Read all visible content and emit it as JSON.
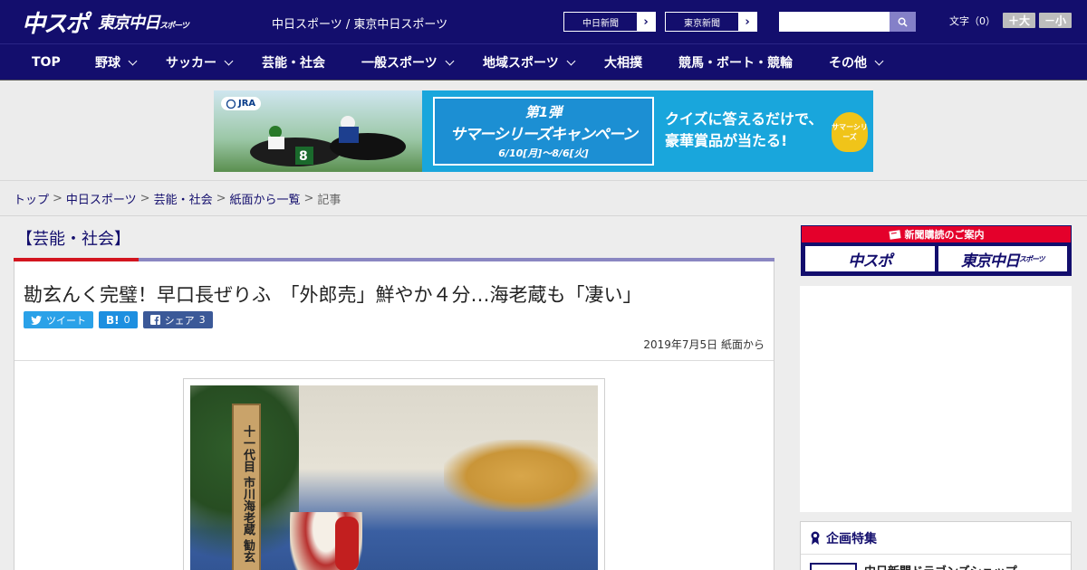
{
  "header": {
    "logo_main": "中スポ",
    "logo_sub": "東京中日",
    "logo_sub_small": "スポーツ",
    "sitename": "中日スポーツ / 東京中日スポーツ",
    "paper_buttons": [
      "中日新聞",
      "東京新聞"
    ],
    "search_placeholder": "",
    "fontsize_label": "文字（0）",
    "fontsize_bigger": "＋大",
    "fontsize_smaller": "－小"
  },
  "nav": {
    "items": [
      {
        "label": "TOP"
      },
      {
        "label": "野球"
      },
      {
        "label": "サッカー"
      },
      {
        "label": "芸能・社会"
      },
      {
        "label": "一般スポーツ"
      },
      {
        "label": "地域スポーツ"
      },
      {
        "label": "大相撲"
      },
      {
        "label": "競馬・ボート・競輪"
      },
      {
        "label": "その他"
      }
    ]
  },
  "banner": {
    "brand": "JRA",
    "box_line1": "第1弾",
    "box_line2": "サマーシリーズキャンペーン",
    "box_line3": "6/10[月]～8/6[火]",
    "message_line1": "クイズに答えるだけで、",
    "message_line2": "豪華賞品が当たる!",
    "badge": "サマーシリーズ"
  },
  "breadcrumb": {
    "items": [
      "トップ",
      "中日スポーツ",
      "芸能・社会",
      "紙面から一覧"
    ],
    "current": "記事"
  },
  "article": {
    "category": "【芸能・社会】",
    "title": "勘玄んく完璧！早口長ぜりふ　「外郎売」鮮やか４分…海老蔵も「凄い」",
    "share": {
      "tweet_label": "ツイート",
      "hatena_label": "B!",
      "hatena_count": "0",
      "facebook_label": "シェア",
      "facebook_count": "3"
    },
    "date": "2019年7月5日 紙面から",
    "photo_sign_text": "十一代目 市川海老蔵 勧玄"
  },
  "sidebar": {
    "subscribe_header": "新聞購読のご案内",
    "subscribe_logo1": "中スポ",
    "subscribe_logo2": "東京中日",
    "subscribe_logo2_small": "スポーツ",
    "feature_title": "企画特集",
    "feature_item": "中日新聞ドラゴンズショップ"
  },
  "colors": {
    "brand_navy": "#130e6d",
    "accent_red": "#d3151f",
    "subscribe_red": "#e4002b",
    "twitter": "#2aa1e8",
    "facebook": "#3b5998"
  }
}
